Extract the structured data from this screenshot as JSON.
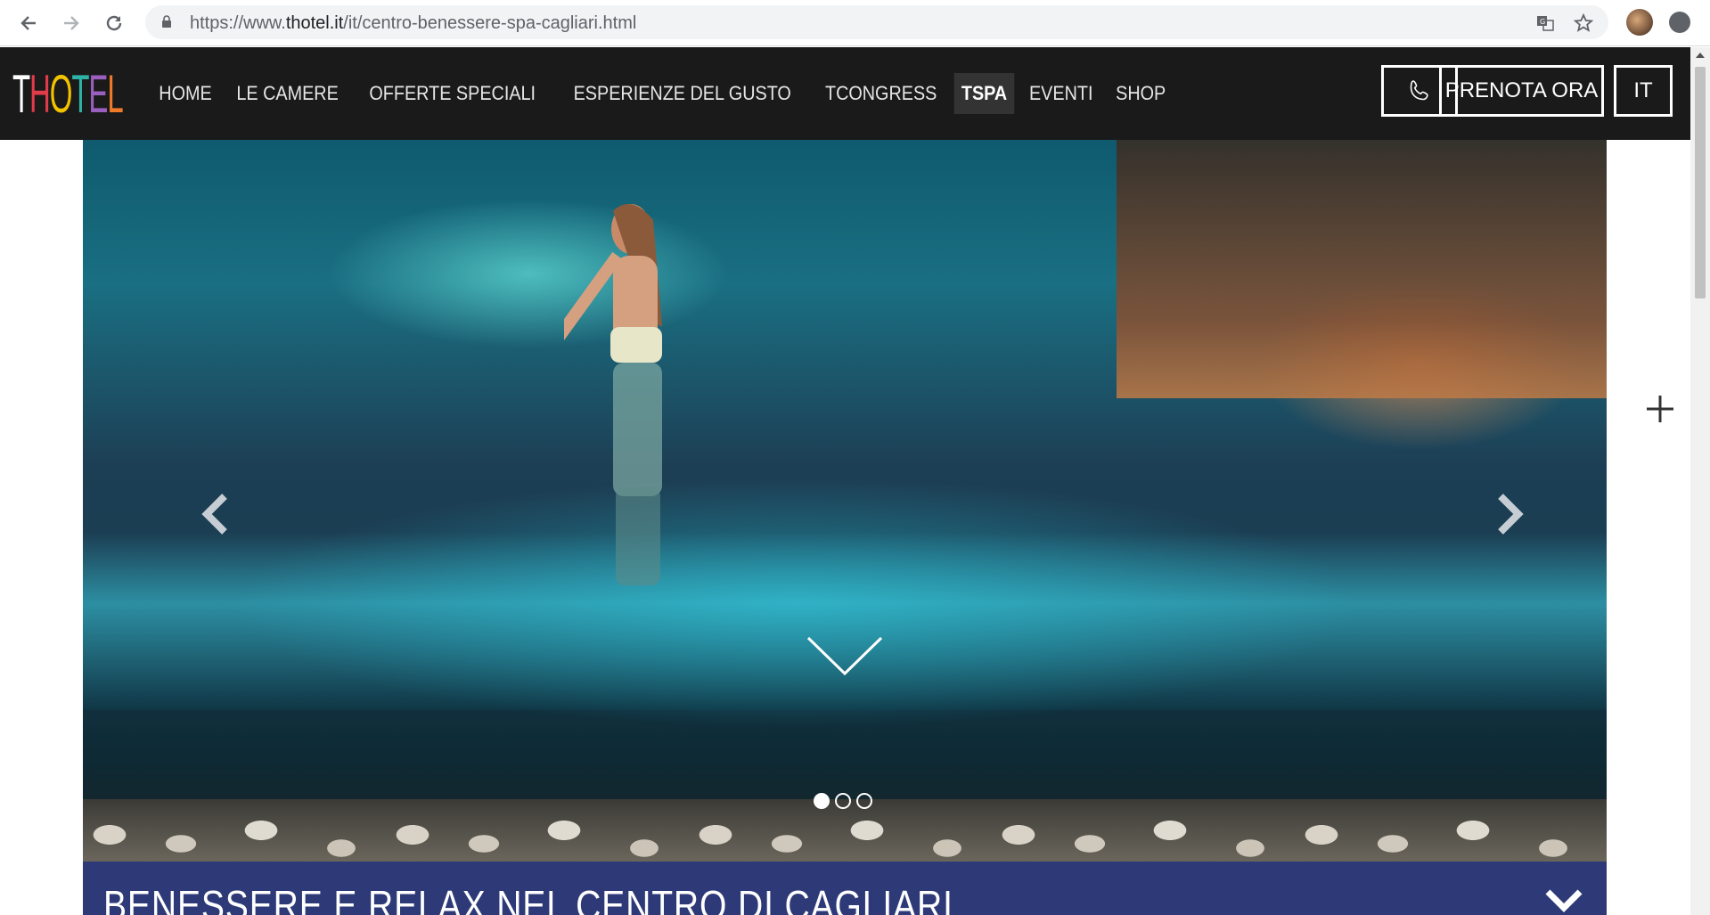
{
  "browser": {
    "url_prefix": "https://www.",
    "url_domain": "thotel.it",
    "url_path": "/it/centro-benessere-spa-cagliari.html"
  },
  "header": {
    "logo_letters": [
      "T",
      "H",
      "O",
      "T",
      "E",
      "L"
    ],
    "logo_colors": [
      "#ffffff",
      "#e23b4a",
      "#f2c200",
      "#2fb2a6",
      "#9b5fc0",
      "#ef7a2a"
    ],
    "nav": [
      {
        "label": "HOME"
      },
      {
        "label": "LE CAMERE"
      },
      {
        "label": "OFFERTE SPECIALI"
      },
      {
        "label": "ESPERIENZE DEL GUSTO"
      },
      {
        "label": "TCONGRESS"
      },
      {
        "label": "TSPA",
        "active": true
      },
      {
        "label": "EVENTI"
      },
      {
        "label": "SHOP"
      }
    ],
    "book_label": "PRENOTA ORA",
    "lang_label": "IT"
  },
  "hero": {
    "slides_total": 3,
    "active_slide": 1
  },
  "section": {
    "title": "BENESSERE E RELAX NEL CENTRO DI CAGLIARI"
  },
  "colors": {
    "header_bg": "#1a1a1a",
    "title_bar_bg": "#2e3a78"
  }
}
